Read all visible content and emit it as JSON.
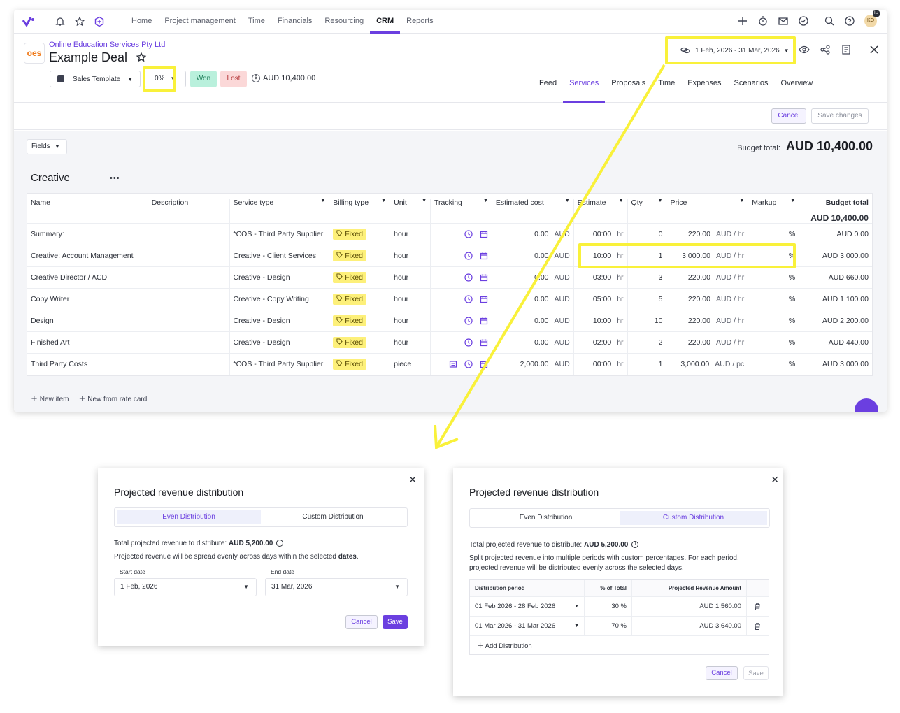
{
  "nav": {
    "links": [
      "Home",
      "Project management",
      "Time",
      "Financials",
      "Resourcing",
      "CRM",
      "Reports"
    ],
    "active": "CRM",
    "avatar_initials": "KO",
    "avatar_badge": "IU"
  },
  "deal": {
    "company": "Online Education Services Pty Ltd",
    "logo_text": "oes",
    "title": "Example Deal",
    "template": "Sales Template",
    "probability": "0%",
    "won_label": "Won",
    "lost_label": "Lost",
    "amount": "AUD 10,400.00",
    "date_range": "1 Feb, 2026 - 31 Mar, 2026",
    "tabs": [
      "Feed",
      "Services",
      "Proposals",
      "Time",
      "Expenses",
      "Scenarios",
      "Overview"
    ],
    "active_tab": "Services"
  },
  "actions": {
    "cancel": "Cancel",
    "save": "Save changes"
  },
  "services": {
    "fields_label": "Fields",
    "budget_label": "Budget total:",
    "budget_value": "AUD 10,400.00",
    "section": "Creative",
    "columns": {
      "name": "Name",
      "description": "Description",
      "service_type": "Service type",
      "billing_type": "Billing type",
      "unit": "Unit",
      "tracking": "Tracking",
      "estimated_cost": "Estimated cost",
      "estimate": "Estimate",
      "qty": "Qty",
      "price": "Price",
      "markup": "Markup",
      "budget_total": "Budget total",
      "budget_total_value": "AUD 10,400.00"
    },
    "rows": [
      {
        "name": "Summary:",
        "service_type": "*COS - Third Party Supplier",
        "billing": "Fixed",
        "unit": "hour",
        "cost": "0.00",
        "cost_cur": "AUD",
        "estimate": "00:00",
        "est_unit": "hr",
        "qty": "0",
        "price": "220.00",
        "price_unit": "AUD / hr",
        "markup": "%",
        "total": "AUD 0.00"
      },
      {
        "name": "Creative: Account Management",
        "service_type": "Creative - Client Services",
        "billing": "Fixed",
        "unit": "hour",
        "cost": "0.00",
        "cost_cur": "AUD",
        "estimate": "10:00",
        "est_unit": "hr",
        "qty": "1",
        "price": "3,000.00",
        "price_unit": "AUD / hr",
        "markup": "%",
        "total": "AUD 3,000.00"
      },
      {
        "name": "Creative Director / ACD",
        "service_type": "Creative - Design",
        "billing": "Fixed",
        "unit": "hour",
        "cost": "0.00",
        "cost_cur": "AUD",
        "estimate": "03:00",
        "est_unit": "hr",
        "qty": "3",
        "price": "220.00",
        "price_unit": "AUD / hr",
        "markup": "%",
        "total": "AUD 660.00"
      },
      {
        "name": "Copy Writer",
        "service_type": "Creative - Copy Writing",
        "billing": "Fixed",
        "unit": "hour",
        "cost": "0.00",
        "cost_cur": "AUD",
        "estimate": "05:00",
        "est_unit": "hr",
        "qty": "5",
        "price": "220.00",
        "price_unit": "AUD / hr",
        "markup": "%",
        "total": "AUD 1,100.00"
      },
      {
        "name": "Design",
        "service_type": "Creative - Design",
        "billing": "Fixed",
        "unit": "hour",
        "cost": "0.00",
        "cost_cur": "AUD",
        "estimate": "10:00",
        "est_unit": "hr",
        "qty": "10",
        "price": "220.00",
        "price_unit": "AUD / hr",
        "markup": "%",
        "total": "AUD 2,200.00"
      },
      {
        "name": "Finished Art",
        "service_type": "Creative - Design",
        "billing": "Fixed",
        "unit": "hour",
        "cost": "0.00",
        "cost_cur": "AUD",
        "estimate": "02:00",
        "est_unit": "hr",
        "qty": "2",
        "price": "220.00",
        "price_unit": "AUD / hr",
        "markup": "%",
        "total": "AUD 440.00"
      },
      {
        "name": "Third Party Costs",
        "service_type": "*COS - Third Party Supplier",
        "billing": "Fixed",
        "unit": "piece",
        "cost": "2,000.00",
        "cost_cur": "AUD",
        "estimate": "00:00",
        "est_unit": "hr",
        "qty": "1",
        "price": "3,000.00",
        "price_unit": "AUD / pc",
        "markup": "%",
        "total": "AUD 3,000.00"
      }
    ],
    "new_item": "New item",
    "new_from_rate": "New from rate card"
  },
  "modal_even": {
    "title": "Projected revenue distribution",
    "tab_even": "Even Distribution",
    "tab_custom": "Custom Distribution",
    "total_label": "Total projected revenue to distribute:",
    "total_value": "AUD 5,200.00",
    "desc": "Projected revenue will be spread evenly across days within the selected",
    "desc_bold": "dates",
    "start_label": "Start date",
    "start_value": "1 Feb, 2026",
    "end_label": "End date",
    "end_value": "31 Mar, 2026",
    "cancel": "Cancel",
    "save": "Save"
  },
  "modal_custom": {
    "title": "Projected revenue distribution",
    "tab_even": "Even Distribution",
    "tab_custom": "Custom Distribution",
    "total_label": "Total projected revenue to distribute:",
    "total_value": "AUD 5,200.00",
    "desc1": "Split projected revenue into multiple periods with custom percentages. For each period,",
    "desc2": "projected revenue will be distributed evenly across the selected days.",
    "col_period": "Distribution period",
    "col_pct": "% of Total",
    "col_amount": "Projected Revenue Amount",
    "rows": [
      {
        "period": "01 Feb 2026 - 28 Feb 2026",
        "pct": "30 %",
        "amount": "AUD 1,560.00"
      },
      {
        "period": "01 Mar 2026 - 31 Mar 2026",
        "pct": "70 %",
        "amount": "AUD 3,640.00"
      }
    ],
    "add": "Add Distribution",
    "cancel": "Cancel",
    "save": "Save"
  },
  "colors": {
    "accent": "#6b3fe0",
    "highlight": "#f9f13a",
    "fixed_chip": "#fdf07a",
    "won": "#b9f0dc",
    "lost": "#fbd8d8"
  }
}
